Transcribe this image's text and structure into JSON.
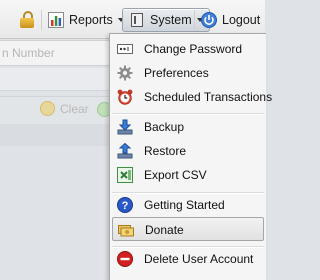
{
  "toolbar": {
    "reports_label": "Reports",
    "system_label": "System",
    "logout_label": "Logout"
  },
  "background": {
    "field_placeholder": "n Number",
    "clear_label": "Clear"
  },
  "menu": {
    "items": [
      {
        "label": "Change Password",
        "icon": "password-field-icon"
      },
      {
        "label": "Preferences",
        "icon": "gear-icon"
      },
      {
        "label": "Scheduled Transactions",
        "icon": "alarm-clock-icon"
      },
      {
        "label": "Backup",
        "icon": "download-arrow-icon"
      },
      {
        "label": "Restore",
        "icon": "upload-arrow-icon"
      },
      {
        "label": "Export CSV",
        "icon": "spreadsheet-export-icon"
      },
      {
        "label": "Getting Started",
        "icon": "help-icon"
      },
      {
        "label": "Donate",
        "icon": "money-icon"
      },
      {
        "label": "Delete User Account",
        "icon": "delete-icon"
      }
    ],
    "highlighted": "Donate"
  },
  "colors": {
    "menu_bg": "#f5f5f5",
    "highlight_border": "#a6a6a6",
    "help_blue": "#2a58c9",
    "delete_red": "#d21f1f"
  }
}
